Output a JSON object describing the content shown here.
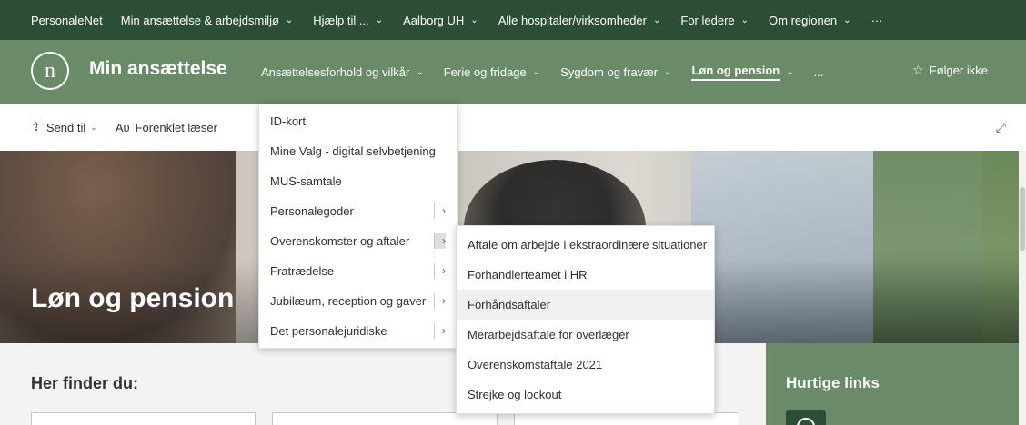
{
  "topnav": {
    "items": [
      {
        "label": "PersonaleNet",
        "chevron": false
      },
      {
        "label": "Min ansættelse & arbejdsmiljø",
        "chevron": true
      },
      {
        "label": "Hjælp til ...",
        "chevron": true
      },
      {
        "label": "Aalborg UH",
        "chevron": true
      },
      {
        "label": "Alle hospitaler/virksomheder",
        "chevron": true
      },
      {
        "label": "For ledere",
        "chevron": true
      },
      {
        "label": "Om regionen",
        "chevron": true
      }
    ],
    "more": "···"
  },
  "site": {
    "logo_letter": "n",
    "title": "Min ansættelse",
    "nav": [
      {
        "label": "Ansættelsesforhold og vilkår"
      },
      {
        "label": "Ferie og fridage"
      },
      {
        "label": "Sygdom og fravær"
      },
      {
        "label": "Løn og pension",
        "active": true
      }
    ],
    "more": "...",
    "follow_label": "Følger ikke"
  },
  "commandbar": {
    "send_label": "Send til",
    "reader_label": "Forenklet læser"
  },
  "hero": {
    "title": "Løn og pension"
  },
  "content": {
    "section_title": "Her finder du:",
    "quicklinks_title": "Hurtige links"
  },
  "menu1": {
    "items": [
      {
        "label": "ID-kort",
        "submenu": false
      },
      {
        "label": "Mine Valg - digital selvbetjening",
        "submenu": false
      },
      {
        "label": "MUS-samtale",
        "submenu": false
      },
      {
        "label": "Personalegoder",
        "submenu": true
      },
      {
        "label": "Overenskomster og aftaler",
        "submenu": true,
        "open": true
      },
      {
        "label": "Fratrædelse",
        "submenu": true
      },
      {
        "label": "Jubilæum, reception og gaver",
        "submenu": true
      },
      {
        "label": "Det personalejuridiske",
        "submenu": true
      }
    ]
  },
  "menu2": {
    "items": [
      {
        "label": "Aftale om arbejde i ekstraordinære situationer"
      },
      {
        "label": "Forhandlerteamet i HR"
      },
      {
        "label": "Forhåndsaftaler",
        "hover": true
      },
      {
        "label": "Merarbejdsaftale for overlæger"
      },
      {
        "label": "Overenskomstaftale 2021"
      },
      {
        "label": "Strejke og lockout"
      }
    ]
  },
  "icons": {
    "chevron": "⌄",
    "submenu_arrow": "›",
    "star": "☆",
    "share": "⇪",
    "reader": "A",
    "expand": "⤢"
  },
  "colors": {
    "topnav_bg": "#2d4e36",
    "header_bg": "#6a8b67",
    "quicklinks_bg": "#6a8b67"
  }
}
